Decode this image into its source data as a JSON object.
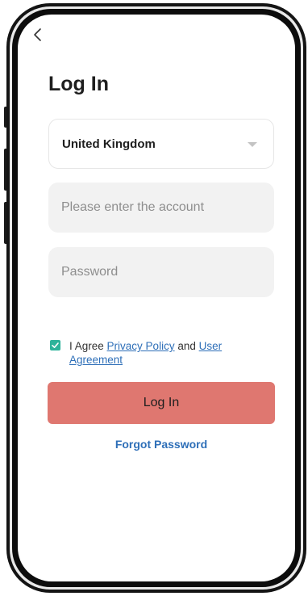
{
  "header": {
    "back_icon": "chevron-left-icon",
    "title": "Log In"
  },
  "form": {
    "country": {
      "selected": "United Kingdom",
      "caret_icon": "caret-down-icon"
    },
    "account": {
      "value": "",
      "placeholder": "Please enter the account"
    },
    "password": {
      "value": "",
      "placeholder": "Password"
    }
  },
  "agreement": {
    "checked": true,
    "check_icon": "checkmark-icon",
    "prefix": "I Agree",
    "privacy_link": "Privacy Policy",
    "conjunction": "and",
    "user_agreement_link": "User Agreement"
  },
  "actions": {
    "login_label": "Log In",
    "forgot_label": "Forgot Password"
  },
  "colors": {
    "primary_button": "#df7770",
    "link": "#2e6fb8",
    "checkbox": "#2db39a",
    "input_background": "#f2f2f2"
  }
}
